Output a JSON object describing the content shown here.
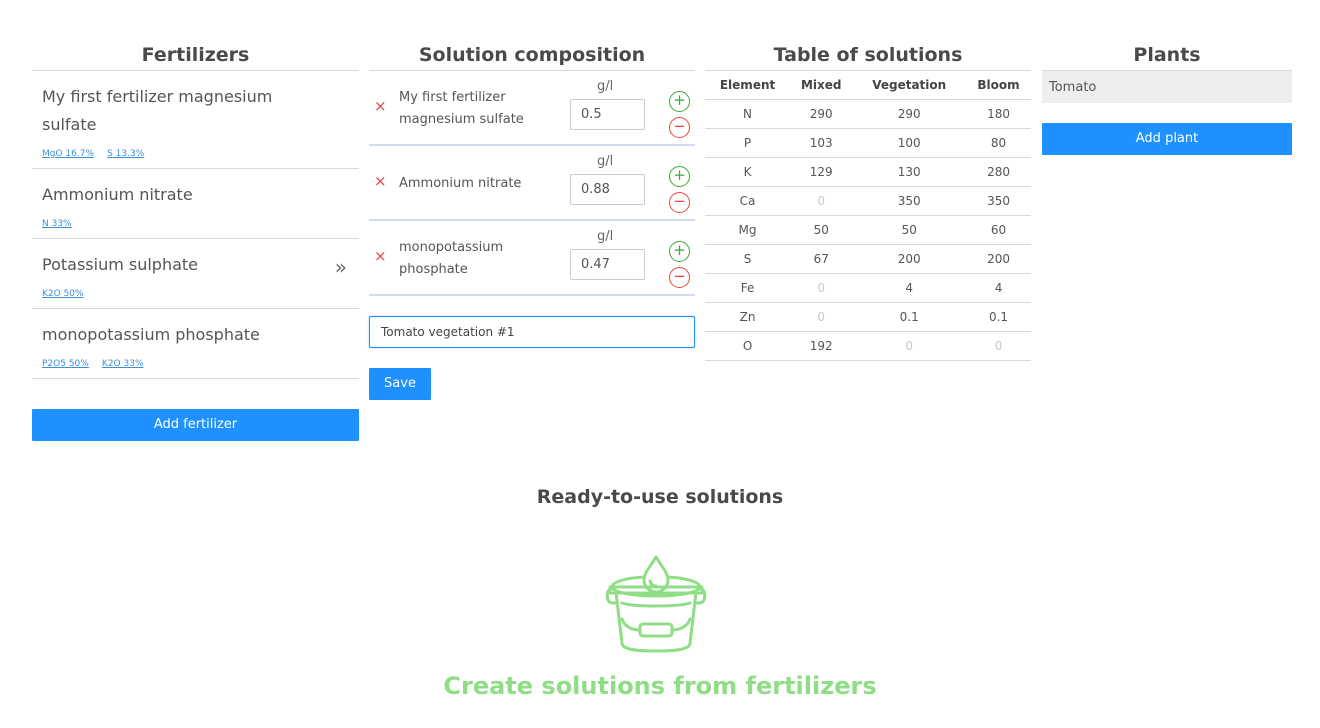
{
  "fertilizers": {
    "title": "Fertilizers",
    "items": [
      {
        "name": "My first fertilizer magnesium sulfate",
        "tags": [
          "MgO 16.7%",
          "S 13.3%"
        ]
      },
      {
        "name": "Ammonium nitrate",
        "tags": [
          "N 33%"
        ]
      },
      {
        "name": "Potassium sulphate",
        "tags": [
          "K2O 50%"
        ],
        "arrow": "»"
      },
      {
        "name": "monopotassium phosphate",
        "tags": [
          "P2O5 50%",
          "K2O 33%"
        ]
      }
    ],
    "add_label": "Add fertilizer"
  },
  "composition": {
    "title": "Solution composition",
    "unit": "g/l",
    "rows": [
      {
        "name": "My first fertilizer magnesium sulfate",
        "value": "0.5"
      },
      {
        "name": "Ammonium nitrate",
        "value": "0.88"
      },
      {
        "name": "monopotassium phosphate",
        "value": "0.47"
      }
    ],
    "remove_glyph": "×",
    "plus_glyph": "+",
    "minus_glyph": "−",
    "solution_name": "Tomato vegetation #1",
    "save_label": "Save"
  },
  "solutions_table": {
    "title": "Table of solutions",
    "headers": [
      "Element",
      "Mixed",
      "Vegetation",
      "Bloom"
    ],
    "rows": [
      [
        "N",
        "290",
        "290",
        "180"
      ],
      [
        "P",
        "103",
        "100",
        "80"
      ],
      [
        "K",
        "129",
        "130",
        "280"
      ],
      [
        "Ca",
        "0",
        "350",
        "350"
      ],
      [
        "Mg",
        "50",
        "50",
        "60"
      ],
      [
        "S",
        "67",
        "200",
        "200"
      ],
      [
        "Fe",
        "0",
        "4",
        "4"
      ],
      [
        "Zn",
        "0",
        "0.1",
        "0.1"
      ],
      [
        "O",
        "192",
        "0",
        "0"
      ]
    ]
  },
  "plants": {
    "title": "Plants",
    "items": [
      "Tomato"
    ],
    "add_label": "Add plant"
  },
  "ready": {
    "title": "Ready-to-use solutions",
    "icon": "bucket-drop-icon",
    "cta": "Create solutions from fertilizers"
  },
  "colors": {
    "accent": "#1e90ff",
    "plus": "#3aa93a",
    "minus": "#e8453c",
    "cta_green": "#8fdd85",
    "zero_gray": "#c8c8c8"
  }
}
